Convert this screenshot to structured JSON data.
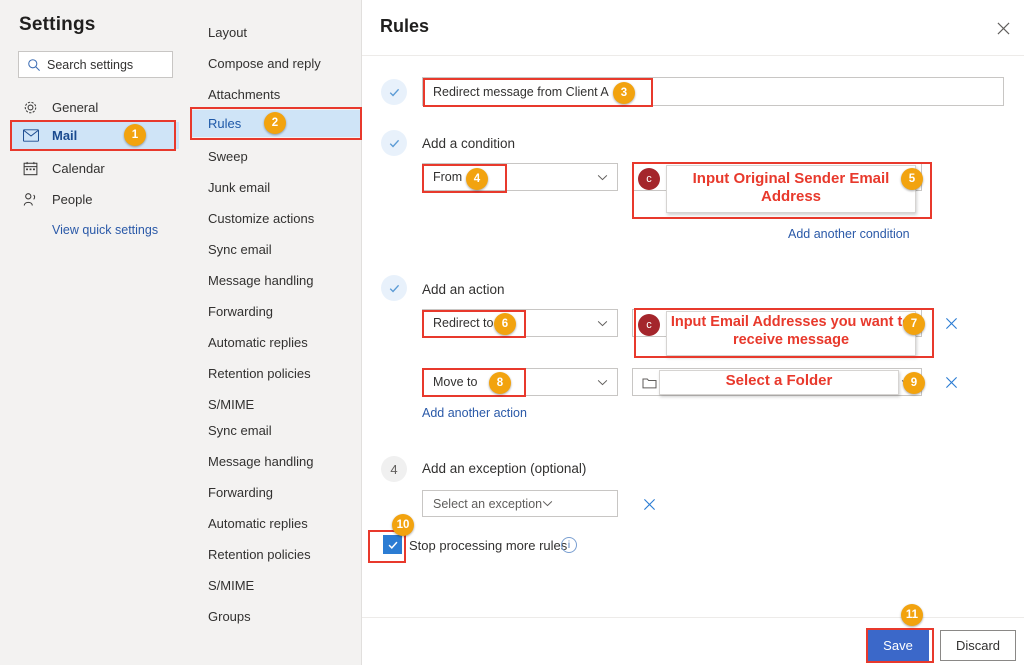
{
  "sidebar": {
    "title": "Settings",
    "search": {
      "value": "",
      "placeholder": "Search settings",
      "icon": "search-icon"
    },
    "items": [
      {
        "label": "General",
        "icon": "gear-icon",
        "active": false,
        "badge": null
      },
      {
        "label": "Mail",
        "icon": "envelope-icon",
        "active": true,
        "badge": "1"
      },
      {
        "label": "Calendar",
        "icon": "calendar-icon",
        "active": false,
        "badge": null
      },
      {
        "label": "People",
        "icon": "people-icon",
        "active": false,
        "badge": null
      }
    ],
    "quick_link": "View quick settings"
  },
  "subnav": {
    "items": [
      {
        "label": "Layout",
        "active": false,
        "badge": null
      },
      {
        "label": "Compose and reply",
        "active": false,
        "badge": null
      },
      {
        "label": "Attachments",
        "active": false,
        "badge": null
      },
      {
        "label": "Rules",
        "active": true,
        "badge": "2"
      },
      {
        "label": "Sweep",
        "active": false,
        "badge": null
      },
      {
        "label": "Junk email",
        "active": false,
        "badge": null
      },
      {
        "label": "Customize actions",
        "active": false,
        "badge": null
      },
      {
        "label": "Sync email",
        "active": false,
        "badge": null
      },
      {
        "label": "Message handling",
        "active": false,
        "badge": null
      },
      {
        "label": "Forwarding",
        "active": false,
        "badge": null
      },
      {
        "label": "Automatic replies",
        "active": false,
        "badge": null
      },
      {
        "label": "Retention policies",
        "active": false,
        "badge": null
      },
      {
        "label": "S/MIME",
        "active": false,
        "badge": null
      },
      {
        "label": "Sync email",
        "active": false,
        "badge": null
      },
      {
        "label": "Message handling",
        "active": false,
        "badge": null
      },
      {
        "label": "Forwarding",
        "active": false,
        "badge": null
      },
      {
        "label": "Automatic replies",
        "active": false,
        "badge": null
      },
      {
        "label": "Retention policies",
        "active": false,
        "badge": null
      },
      {
        "label": "S/MIME",
        "active": false,
        "badge": null
      },
      {
        "label": "Groups",
        "active": false,
        "badge": null
      }
    ]
  },
  "main": {
    "title": "Rules",
    "close_icon": "close-icon",
    "rule_name": {
      "value": "Redirect message from Client A",
      "badge": "3"
    },
    "condition": {
      "heading": "Add a condition",
      "select_value": "From",
      "select_badge": "4",
      "value_overlay_text": "Input Original Sender Email Address",
      "value_overlay_badge": "5",
      "avatar_initial": "c",
      "add_link": "Add another condition",
      "caption": "Input Original Sender\nEmail Address"
    },
    "action": {
      "heading": "Add an action",
      "rows": [
        {
          "select_value": "Redirect to",
          "select_badge": "6",
          "overlay_text": "Input Email Addresses you want to receive message",
          "overlay_badge": "7",
          "avatar_initial": "c",
          "remove_icon": "close-icon",
          "remove_badge": null
        },
        {
          "select_value": "Move to",
          "select_badge": "8",
          "overlay_text": "Select a Folder",
          "overlay_badge": null,
          "folder_icon": "folder-icon",
          "remove_icon": "close-icon",
          "remove_badge": "9"
        }
      ],
      "add_link": "Add another action"
    },
    "exception": {
      "step_number": "4",
      "heading": "Add an exception (optional)",
      "select_placeholder": "Select an exception",
      "remove_icon": "close-icon"
    },
    "stop_processing": {
      "label": "Stop processing more rules",
      "checked": true,
      "badge": "10",
      "info_icon": "info-icon"
    },
    "footer": {
      "save_label": "Save",
      "save_badge": "11",
      "discard_label": "Discard"
    }
  },
  "colors": {
    "annotation_red": "#e8392c",
    "badge_orange": "#f2a30f",
    "primary_blue": "#3b68c9",
    "link_blue": "#2a59a8",
    "active_nav_bg": "#cfe4f7",
    "avatar_red": "#a4262c"
  }
}
